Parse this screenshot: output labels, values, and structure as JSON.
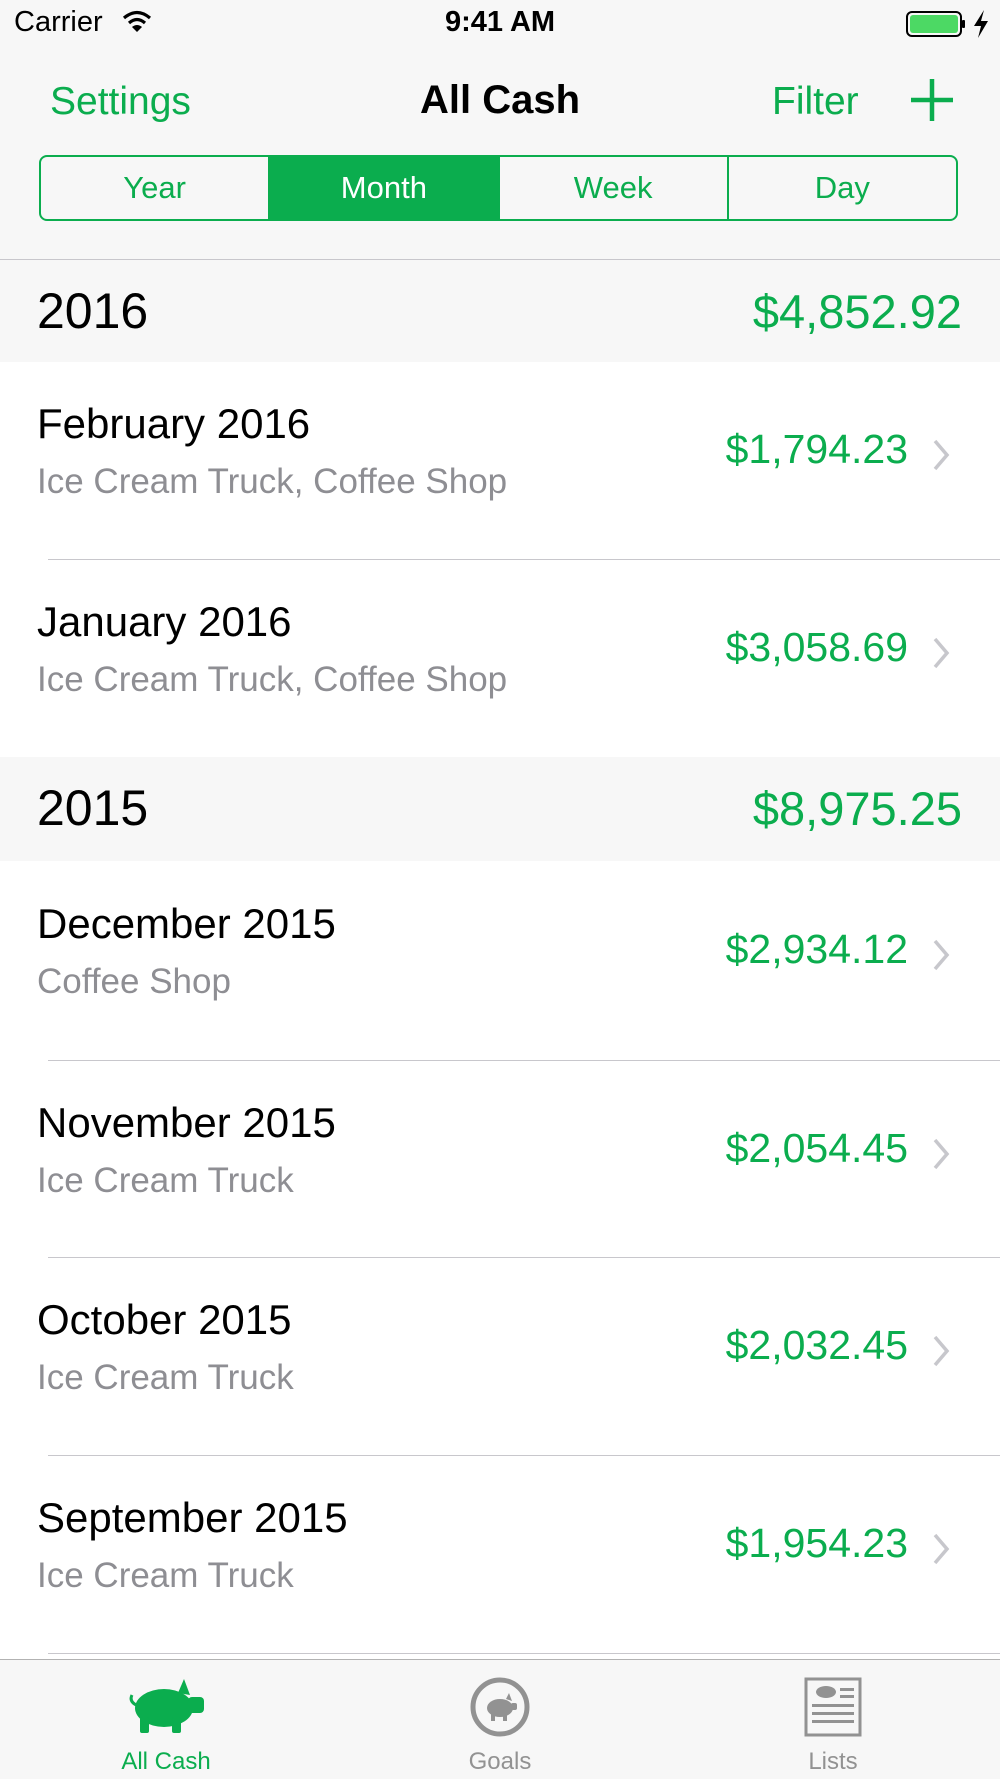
{
  "status_bar": {
    "carrier": "Carrier",
    "time": "9:41 AM"
  },
  "nav": {
    "left_button": "Settings",
    "title": "All Cash",
    "right_button": "Filter",
    "add_icon": "plus-icon"
  },
  "segments": {
    "items": [
      "Year",
      "Month",
      "Week",
      "Day"
    ],
    "selected": "Month"
  },
  "sections": [
    {
      "year": "2016",
      "total": "$4,852.92",
      "rows": [
        {
          "title": "February 2016",
          "subtitle": "Ice Cream Truck, Coffee Shop",
          "amount": "$1,794.23"
        },
        {
          "title": "January 2016",
          "subtitle": "Ice Cream Truck, Coffee Shop",
          "amount": "$3,058.69"
        }
      ]
    },
    {
      "year": "2015",
      "total": "$8,975.25",
      "rows": [
        {
          "title": "December 2015",
          "subtitle": "Coffee Shop",
          "amount": "$2,934.12"
        },
        {
          "title": "November 2015",
          "subtitle": "Ice Cream Truck",
          "amount": "$2,054.45"
        },
        {
          "title": "October 2015",
          "subtitle": "Ice Cream Truck",
          "amount": "$2,032.45"
        },
        {
          "title": "September 2015",
          "subtitle": "Ice Cream Truck",
          "amount": "$1,954.23"
        }
      ]
    }
  ],
  "tab_bar": {
    "tabs": [
      {
        "label": "All Cash",
        "icon": "pig-icon",
        "active": true
      },
      {
        "label": "Goals",
        "icon": "goal-pig-icon",
        "active": false
      },
      {
        "label": "Lists",
        "icon": "list-document-icon",
        "active": false
      }
    ]
  },
  "colors": {
    "accent": "#0bad4e",
    "secondary_text": "#8e8e93",
    "inactive_tab": "#929292",
    "header_bg": "#f7f7f7"
  }
}
